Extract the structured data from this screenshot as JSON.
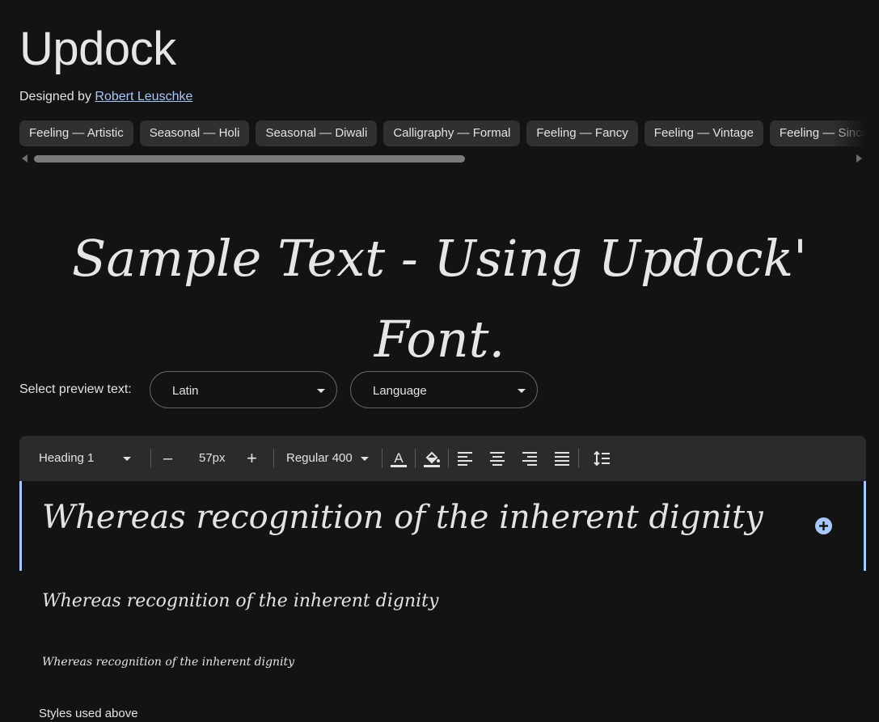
{
  "font": {
    "name": "Updock",
    "designed_by_prefix": "Designed by",
    "designer": "Robert Leuschke"
  },
  "tags": [
    "Feeling — Artistic",
    "Seasonal — Holi",
    "Seasonal — Diwali",
    "Calligraphy — Formal",
    "Feeling — Fancy",
    "Feeling — Vintage",
    "Feeling — Sincere"
  ],
  "sample_text": "Sample Text - Using Updock' Font.",
  "preview": {
    "label": "Select preview text:",
    "script_select": "Latin",
    "language_select": "Language"
  },
  "toolbar": {
    "style_select": "Heading 1",
    "decrease_label": "–",
    "size_value": "57px",
    "increase_label": "+",
    "weight_select": "Regular 400",
    "icons": [
      "text-color-icon",
      "highlight-color-icon",
      "align-left-icon",
      "align-center-icon",
      "align-right-icon",
      "align-justify-icon",
      "line-height-icon"
    ]
  },
  "preview_lines": {
    "large": "Whereas recognition of the inherent dignity",
    "medium": "Whereas recognition of the inherent dignity",
    "small": "Whereas recognition of the inherent dignity"
  },
  "styles_used_label": "Styles used above",
  "colors": {
    "background": "#131313",
    "accent": "#a8c7fa",
    "chip": "#2f3031",
    "toolbar": "#2a2b2c"
  }
}
